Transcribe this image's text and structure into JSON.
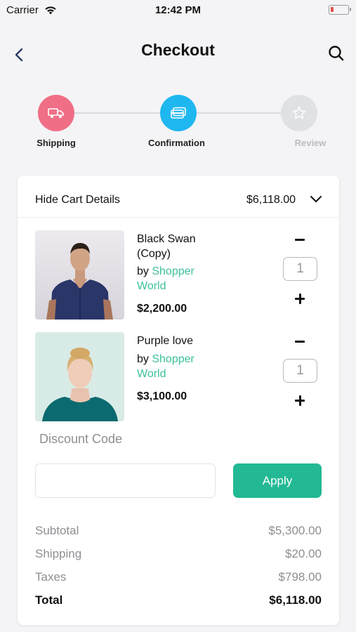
{
  "status_bar": {
    "carrier": "Carrier",
    "time": "12:42 PM"
  },
  "nav": {
    "title": "Checkout",
    "back_icon": "chevron-left-icon",
    "search_icon": "search-icon"
  },
  "stepper": {
    "steps": [
      {
        "label": "Shipping",
        "icon": "truck-icon",
        "color": "#f06f86"
      },
      {
        "label": "Confirmation",
        "icon": "credit-card-icon",
        "color": "#1fb7ef"
      },
      {
        "label": "Review",
        "icon": "star-icon",
        "color": "#dfe1e4"
      }
    ],
    "label_color_done": "#222222",
    "label_color_pending": "#b9bcc1"
  },
  "cart": {
    "toggle_label": "Hide Cart Details",
    "total": "$6,118.00",
    "items": [
      {
        "name": "Black Swan (Copy)",
        "by": "by",
        "vendor": "Shopper World",
        "price": "$2,200.00",
        "quantity": "1"
      },
      {
        "name": "Purple love",
        "by": "by",
        "vendor": "Shopper World",
        "price": "$3,100.00",
        "quantity": "1"
      }
    ]
  },
  "discount": {
    "label": "Discount Code",
    "input_value": "",
    "apply_label": "Apply"
  },
  "summary": {
    "subtotal_label": "Subtotal",
    "subtotal_value": "$5,300.00",
    "shipping_label": "Shipping",
    "shipping_value": "$20.00",
    "taxes_label": "Taxes",
    "taxes_value": "$798.00",
    "total_label": "Total",
    "total_value": "$6,118.00"
  },
  "colors": {
    "accent_green": "#22b994",
    "vendor_green": "#3cc09b"
  }
}
